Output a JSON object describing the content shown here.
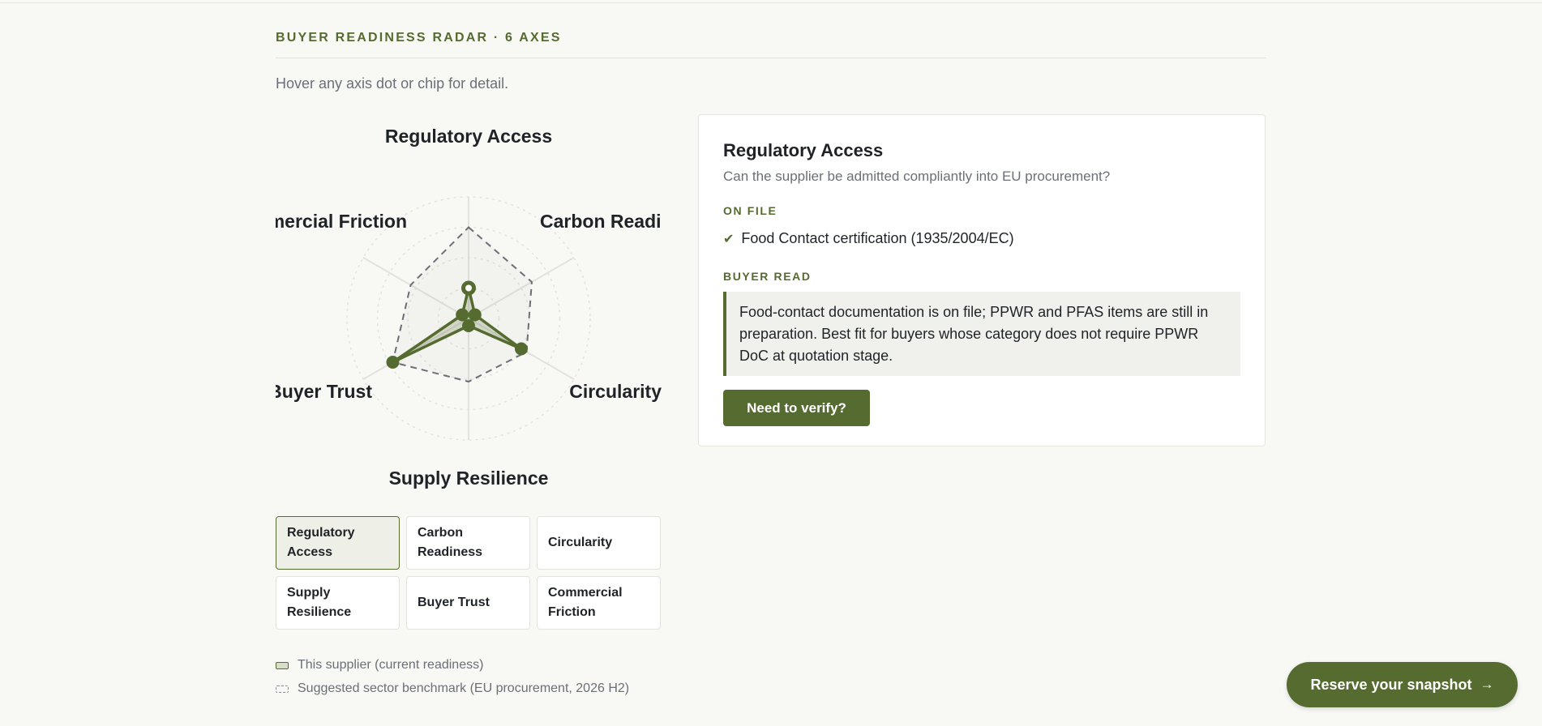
{
  "section": {
    "heading": "BUYER READINESS RADAR · 6 AXES",
    "hint": "Hover any axis dot or chip for detail."
  },
  "chart_data": {
    "type": "radar",
    "axes": [
      "Regulatory Access",
      "Carbon Readiness",
      "Circularity",
      "Supply Resilience",
      "Buyer Trust",
      "Commercial Friction"
    ],
    "scale": [
      0,
      100
    ],
    "grid_rings": 4,
    "series": [
      {
        "name": "This supplier (current readiness)",
        "values": [
          25,
          6,
          50,
          6,
          72,
          6
        ],
        "style": "solid",
        "color": "#556b2f"
      },
      {
        "name": "Suggested sector benchmark (EU procurement, 2026 H2)",
        "values": [
          75,
          60,
          55,
          52,
          72,
          55
        ],
        "style": "dashed",
        "color": "#6b6f76"
      }
    ]
  },
  "chips": [
    {
      "label": "Regulatory Access",
      "active": true
    },
    {
      "label": "Carbon Readiness",
      "active": false
    },
    {
      "label": "Circularity",
      "active": false
    },
    {
      "label": "Supply Resilience",
      "active": false
    },
    {
      "label": "Buyer Trust",
      "active": false
    },
    {
      "label": "Commercial Friction",
      "active": false
    }
  ],
  "legend": {
    "supplier": "This supplier (current readiness)",
    "benchmark": "Suggested sector benchmark (EU procurement, 2026 H2)"
  },
  "detail": {
    "title": "Regulatory Access",
    "subtitle": "Can the supplier be admitted compliantly into EU procurement?",
    "on_file_label": "ON FILE",
    "on_file_item": "Food Contact certification (1935/2004/EC)",
    "buyer_read_label": "BUYER READ",
    "buyer_read_text": "Food-contact documentation is on file; PPWR and PFAS items are still in preparation. Best fit for buyers whose category does not require PPWR DoC at quotation stage.",
    "verify_button": "Need to verify?"
  },
  "cta": {
    "label": "Reserve your snapshot",
    "icon": "arrow-right-icon"
  },
  "colors": {
    "accent": "#556b2f",
    "background": "#f8f8f5"
  }
}
